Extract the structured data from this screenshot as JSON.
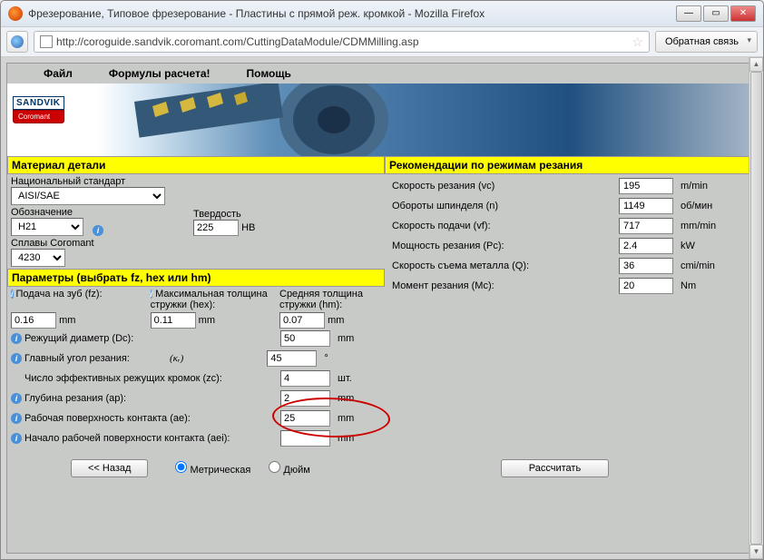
{
  "window": {
    "title": "Фрезерование, Типовое фрезерование - Пластины с прямой реж. кромкой - Mozilla Firefox",
    "url": "http://coroguide.sandvik.coromant.com/CuttingDataModule/CDMMilling.asp",
    "feedback_label": "Обратная связь"
  },
  "menubar": {
    "file": "Файл",
    "formulas": "Формулы расчета!",
    "help": "Помощь"
  },
  "logo": {
    "brand": "SANDVIK",
    "sub": "Coromant"
  },
  "material": {
    "header": "Материал детали",
    "nat_std_label": "Национальный стандарт",
    "nat_std_value": "AISI/SAE",
    "designation_label": "Обозначение",
    "designation_value": "H21",
    "hardness_label": "Твердость",
    "hardness_value": "225",
    "hardness_unit": "HB",
    "alloys_label": "Сплавы Coromant",
    "alloys_value": "4230"
  },
  "params": {
    "header": "Параметры (выбрать fz, hex или hm)",
    "fz_label": "Подача на зуб (fz):",
    "fz_value": "0.16",
    "hex_label": "Максимальная толщина стружки (hex):",
    "hex_value": "0.11",
    "hm_label": "Средняя толщина стружки (hm):",
    "hm_value": "0.07",
    "unit_mm": "mm",
    "dc_label": "Режущий диаметр (Dc):",
    "dc_value": "50",
    "angle_label": "Главный угол резания:",
    "angle_sym": "(κᵣ)",
    "angle_value": "45",
    "angle_unit": "°",
    "zc_label": "Число эффективных режущих кромок (zc):",
    "zc_value": "4",
    "zc_unit": "шт.",
    "ap_label": "Глубина резания (ap):",
    "ap_value": "2",
    "ae_label": "Рабочая поверхность контакта (ae):",
    "ae_value": "25",
    "aei_label": "Начало рабочей поверхности контакта (aei):",
    "aei_value": ""
  },
  "recommend": {
    "header": "Рекомендации по режимам резания",
    "rows": [
      {
        "label": "Скорость резания (vc)",
        "value": "195",
        "unit": "m/min"
      },
      {
        "label": "Обороты шпинделя (n)",
        "value": "1149",
        "unit": "об/мин"
      },
      {
        "label": "Скорость подачи (vf):",
        "value": "717",
        "unit": "mm/min"
      },
      {
        "label": "Мощность резания (Pc):",
        "value": "2.4",
        "unit": "kW"
      },
      {
        "label": "Скорость съема металла (Q):",
        "value": "36",
        "unit": "cmi/min"
      },
      {
        "label": "Момент резания (Mc):",
        "value": "20",
        "unit": "Nm"
      }
    ]
  },
  "buttons": {
    "back": "<< Назад",
    "calc": "Рассчитать"
  },
  "units_radio": {
    "metric": "Метрическая",
    "inch": "Дюйм"
  }
}
